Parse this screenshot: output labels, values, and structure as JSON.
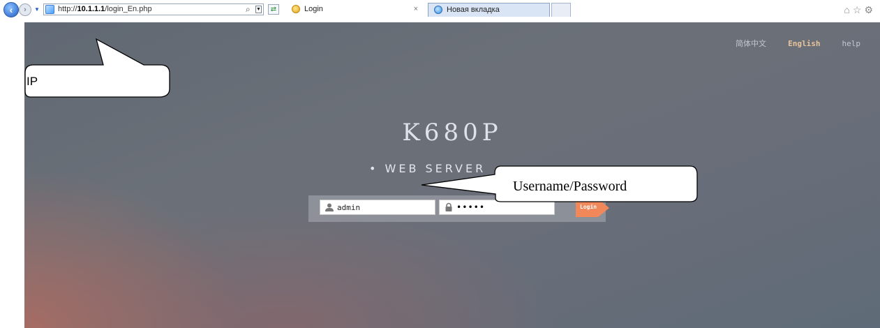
{
  "browser": {
    "url": "http://10.1.1.1/login_En.php",
    "url_host": "10.1.1.1",
    "url_prefix": "http://",
    "url_path": "/login_En.php",
    "tabs": [
      {
        "label": "Login",
        "active": true
      },
      {
        "label": "Новая вкладка",
        "active": false
      }
    ],
    "tab_close_symbol": "×"
  },
  "page": {
    "languages": [
      "简体中文",
      "English"
    ],
    "help_label": "help",
    "product_title": "K680P",
    "subtitle": "• WEB SERVER",
    "login": {
      "username_value": "admin",
      "password_value": "•••••",
      "button_label": "Login"
    }
  },
  "annotations": {
    "ip_label": "IP",
    "credentials_label": "Username/Password"
  },
  "colors": {
    "login_button": "#f0885a",
    "active_language": "#e8c49c",
    "page_bg": "#666c76",
    "corner_glow": "#aa6c62"
  }
}
